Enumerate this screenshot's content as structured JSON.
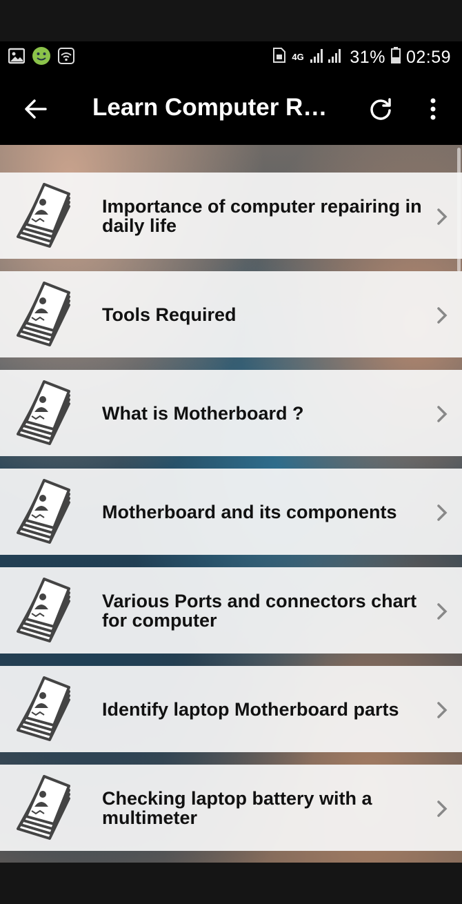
{
  "status_bar": {
    "battery_percent": "31%",
    "time": "02:59",
    "network": "4G"
  },
  "app_bar": {
    "title": "Learn Computer Re..."
  },
  "items": [
    {
      "label": "Importance of computer repairing in daily life"
    },
    {
      "label": "Tools Required"
    },
    {
      "label": "What is Motherboard ?"
    },
    {
      "label": "Motherboard and its components"
    },
    {
      "label": "Various Ports and connectors chart for computer"
    },
    {
      "label": "Identify laptop Motherboard parts"
    },
    {
      "label": "Checking laptop battery with a multimeter"
    }
  ],
  "icons": {
    "item": "document-stack-icon",
    "chevron": "chevron-right-icon"
  }
}
